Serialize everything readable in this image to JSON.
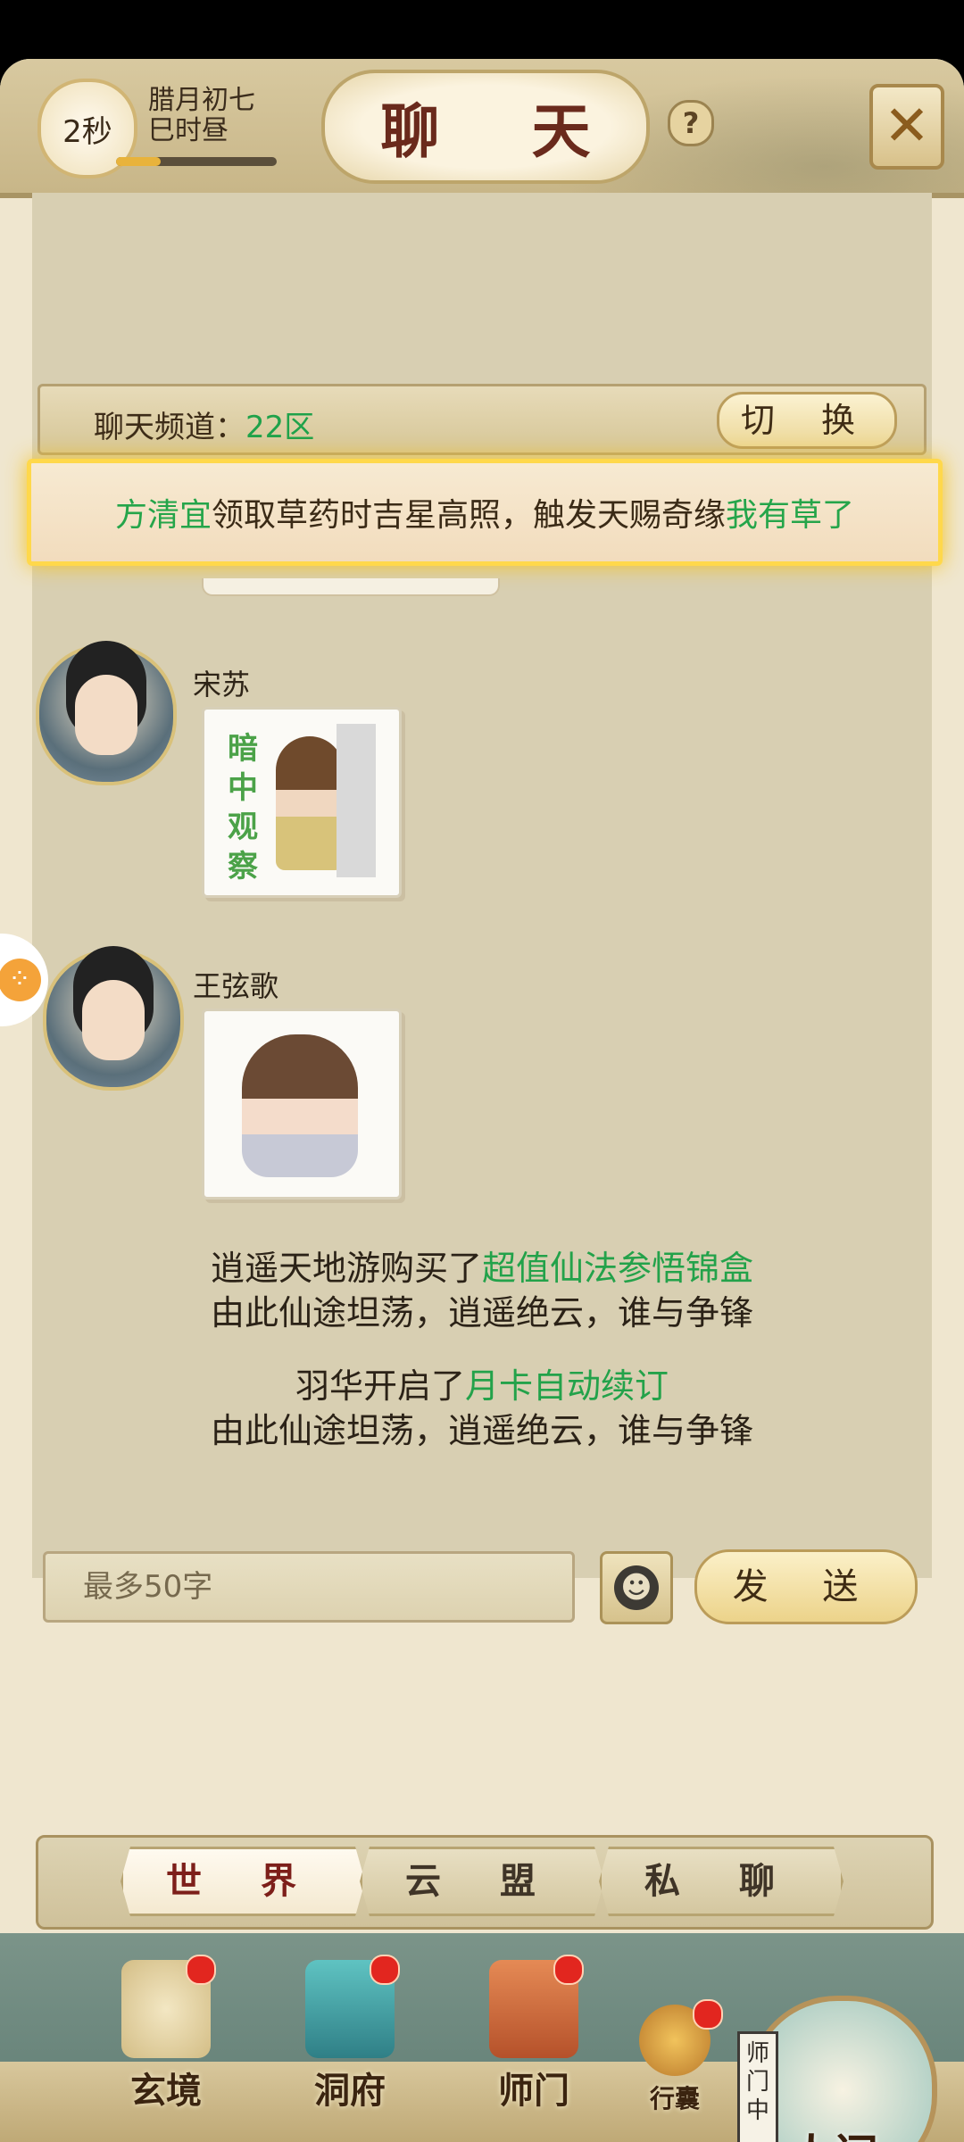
{
  "header": {
    "timer": "2秒",
    "date_line1": "腊月初七",
    "date_line2": "巳时昼",
    "time_progress": 0.28,
    "title": "聊 天",
    "help_label": "?"
  },
  "channel": {
    "label": "聊天频道：",
    "zone": "22区",
    "switch_label": "切 换"
  },
  "announcement": {
    "player": "方清宜",
    "text": "领取草药时吉星高照，触发天赐奇缘",
    "reward": "我有草了"
  },
  "messages": [
    {
      "user": "宋苏",
      "sticker_text": "暗中观察"
    },
    {
      "user": "王弦歌"
    }
  ],
  "system_messages": [
    {
      "pre": "逍遥天地游购买了",
      "item": "超值仙法参悟锦盒",
      "line2": "由此仙途坦荡，逍遥绝云，谁与争锋"
    },
    {
      "pre": "羽华开启了",
      "item": "月卡自动续订",
      "line2": "由此仙途坦荡，逍遥绝云，谁与争锋"
    }
  ],
  "input": {
    "placeholder": "最多50字",
    "send_label": "发 送"
  },
  "tabs": [
    {
      "label": "世 界",
      "active": true
    },
    {
      "label": "云 盟",
      "active": false
    },
    {
      "label": "私 聊",
      "active": false
    }
  ],
  "nav": {
    "items": [
      {
        "label": "玄境"
      },
      {
        "label": "洞府"
      },
      {
        "label": "师门"
      },
      {
        "label": "行囊"
      }
    ],
    "sect_tag": "师门中",
    "world_label": "人间"
  },
  "colors": {
    "accent_green": "#23a24a",
    "title_red": "#6a2a1c",
    "highlight_yellow": "#ffd84b"
  }
}
